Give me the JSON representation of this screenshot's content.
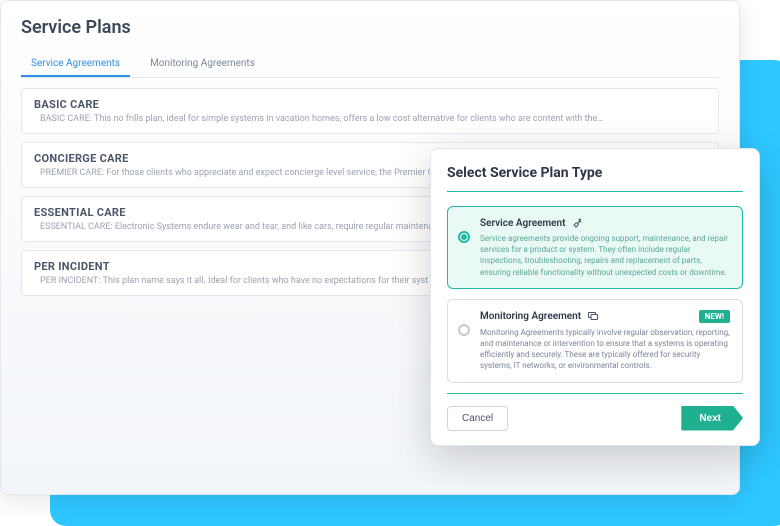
{
  "page": {
    "title": "Service Plans"
  },
  "tabs": [
    {
      "label": "Service Agreements",
      "active": true
    },
    {
      "label": "Monitoring Agreements",
      "active": false
    }
  ],
  "plans": [
    {
      "name": "BASIC CARE",
      "desc": "BASIC CARE: This no frills plan, ideal for simple systems in vacation homes, offers a low cost alternative for clients who are content with the…"
    },
    {
      "name": "CONCIERGE CARE",
      "desc": "PREMIER CARE: For those clients who appreciate and expect concierge level service, the Premier Care plan offers clients a more personalized"
    },
    {
      "name": "ESSENTIAL CARE",
      "desc": "ESSENTIAL CARE: Electronic Systems endure wear and tear, and like cars, require regular maintenance"
    },
    {
      "name": "PER INCIDENT",
      "desc": "PER INCIDENT: This plan name says it all. Ideal for clients who have no expectations for their syst"
    }
  ],
  "modal": {
    "title": "Select Service Plan Type",
    "options": [
      {
        "title": "Service Agreement",
        "icon": "wrench-icon",
        "desc": "Service agreements provide ongoing support, maintenance, and repair services for a product or system. They often include regular inspections, troubleshooting, repairs and replacement of parts, ensuring reliable functionality without unexpected costs or downtime.",
        "selected": true,
        "badge": null
      },
      {
        "title": "Monitoring Agreement",
        "icon": "monitor-icon",
        "desc": "Monitoring Agreements typically involve regular observation, reporting, and maintenance or intervention to ensure that a systems is operating efficiently and securely. These are typically offered for security systems, IT networks, or environmental controls.",
        "selected": false,
        "badge": "NEW!"
      }
    ],
    "cancel": "Cancel",
    "next": "Next"
  }
}
